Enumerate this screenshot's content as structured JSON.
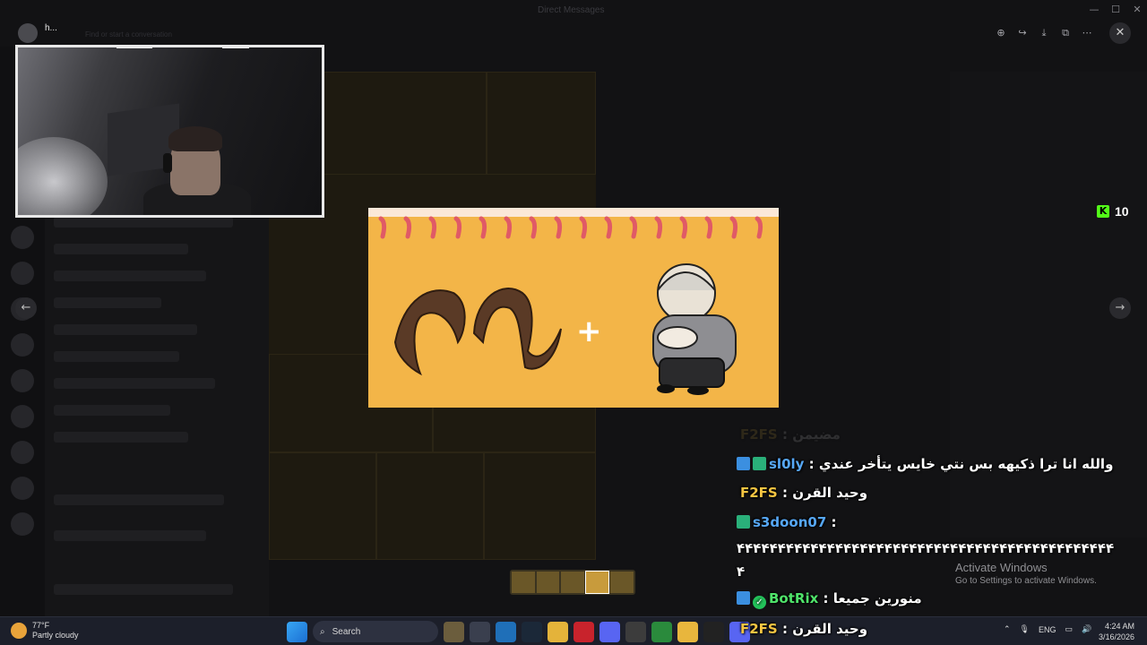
{
  "window": {
    "title": "Direct Messages"
  },
  "user": {
    "name": "h..."
  },
  "background_hint": "Find or start a conversation",
  "viewer": {
    "toolbar_icons": [
      "zoom-in-icon",
      "share-icon",
      "download-icon",
      "open-external-icon",
      "more-icon"
    ],
    "close_label": "✕",
    "prev_label": "←",
    "next_label": "→"
  },
  "stream": {
    "viewer_count": "10",
    "plus_sign": "+"
  },
  "chat": [
    {
      "user": "F2FS",
      "sep": " : ",
      "message": "مضيمن",
      "faded": true
    },
    {
      "user": "sl0ly",
      "sep": " : ",
      "message": "والله انا ترا ذكيهه بس نتي خايس يتأخر عندي"
    },
    {
      "user": "F2FS",
      "sep": " : ",
      "message": "وحيد القرن"
    },
    {
      "user": "s3doon07",
      "sep": " :",
      "message": ""
    },
    {
      "user": "",
      "sep": "",
      "message": "۴۴۴۴۴۴۴۴۴۴۴۴۴۴۴۴۴۴۴۴۴۴۴۴۴۴۴۴۴۴۴۴۴۴۴۴۴۴۴۴۴۴۴۴۴۴"
    },
    {
      "user": "",
      "sep": "",
      "message": "۴"
    },
    {
      "user": "BotRix",
      "sep": " : ",
      "message": "منورين جميعا"
    },
    {
      "user": "F2FS",
      "sep": " : ",
      "message": "وحيد القرن"
    }
  ],
  "system": {
    "activate_title": "Activate Windows",
    "activate_sub": "Go to Settings to activate Windows."
  },
  "taskbar": {
    "temperature": "77°F",
    "weather": "Partly cloudy",
    "search_placeholder": "Search",
    "language": "ENG",
    "time": "4:24 AM",
    "date": "3/16/2026"
  }
}
